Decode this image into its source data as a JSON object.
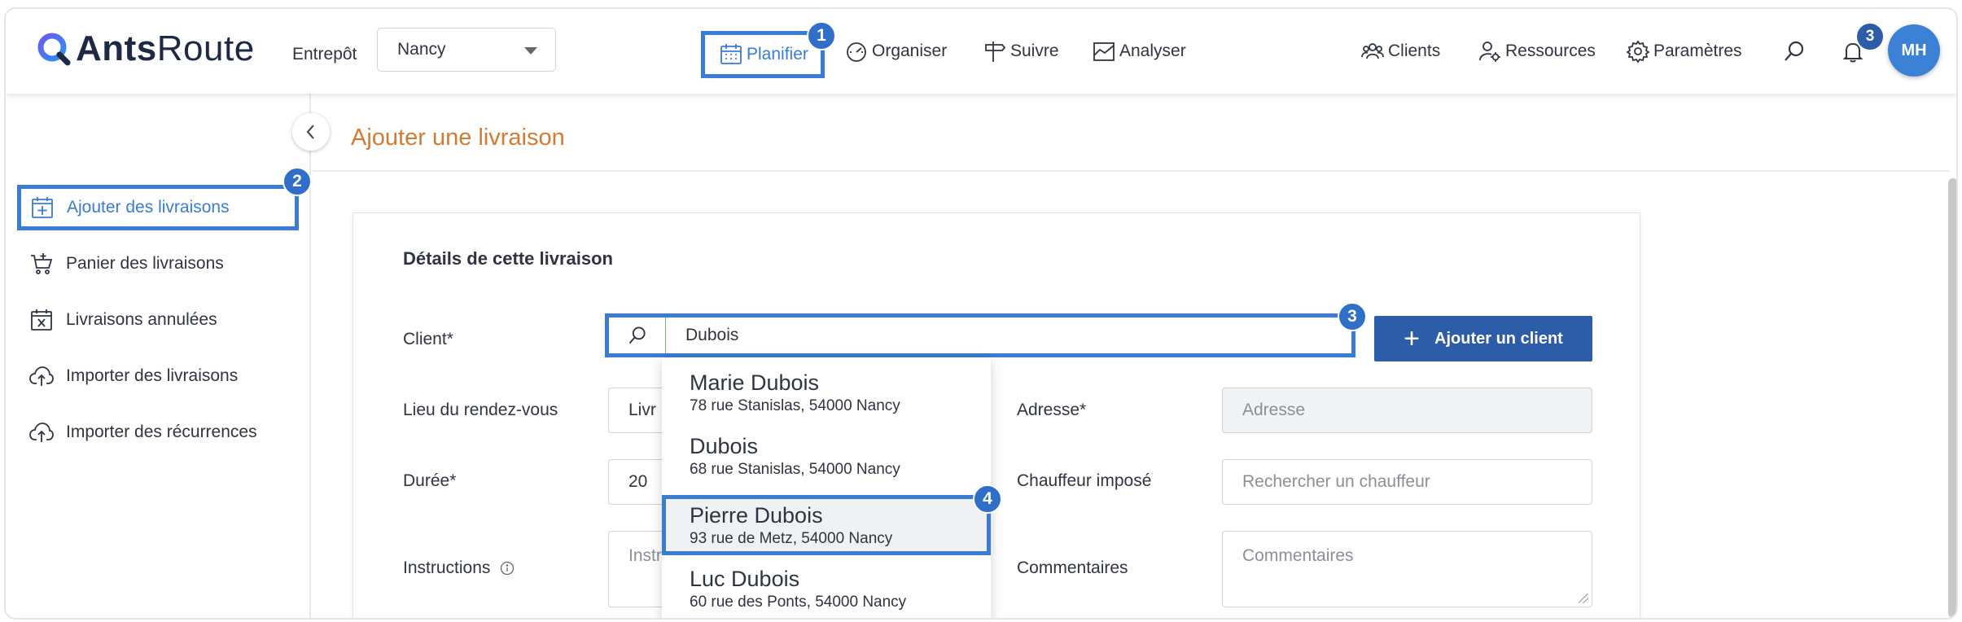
{
  "app": {
    "name_bold": "Ants",
    "name_light": "Route"
  },
  "header": {
    "warehouse_label": "Entrepôt",
    "warehouse_value": "Nancy",
    "nav": {
      "planifier": "Planifier",
      "organiser": "Organiser",
      "suivre": "Suivre",
      "analyser": "Analyser",
      "clients": "Clients",
      "ressources": "Ressources",
      "parametres": "Paramètres"
    },
    "notifications_count": "3",
    "avatar_initials": "MH"
  },
  "steps": {
    "s1": "1",
    "s2": "2",
    "s3": "3",
    "s4": "4"
  },
  "sidebar": {
    "items": [
      {
        "label": "Ajouter des livraisons"
      },
      {
        "label": "Panier des livraisons"
      },
      {
        "label": "Livraisons annulées"
      },
      {
        "label": "Importer des livraisons"
      },
      {
        "label": "Importer des récurrences"
      }
    ]
  },
  "main": {
    "page_title": "Ajouter une livraison",
    "card_title": "Détails de cette livraison",
    "form": {
      "client_label": "Client*",
      "client_value": "Dubois",
      "add_client_label": "Ajouter un client",
      "lieu_label": "Lieu du rendez-vous",
      "lieu_value_partial": "Livr",
      "adresse_label": "Adresse*",
      "adresse_placeholder": "Adresse",
      "duree_label": "Durée*",
      "duree_value": "20",
      "chauffeur_label": "Chauffeur imposé",
      "chauffeur_placeholder": "Rechercher un chauffeur",
      "instructions_label": "Instructions",
      "instructions_partial": "Instr",
      "commentaires_label": "Commentaires",
      "commentaires_placeholder": "Commentaires"
    },
    "dropdown": [
      {
        "name": "Marie Dubois",
        "address": "78 rue Stanislas, 54000 Nancy"
      },
      {
        "name": "Dubois",
        "address": "68 rue Stanislas, 54000 Nancy"
      },
      {
        "name": "Pierre Dubois",
        "address": "93 rue de Metz, 54000 Nancy"
      },
      {
        "name": "Luc Dubois",
        "address": "60 rue des Ponts, 54000 Nancy"
      }
    ]
  },
  "colors": {
    "highlight": "#3a7bd5",
    "badge": "#2f6fc9",
    "primary_button": "#2d5da8",
    "title_orange": "#d37b32"
  }
}
